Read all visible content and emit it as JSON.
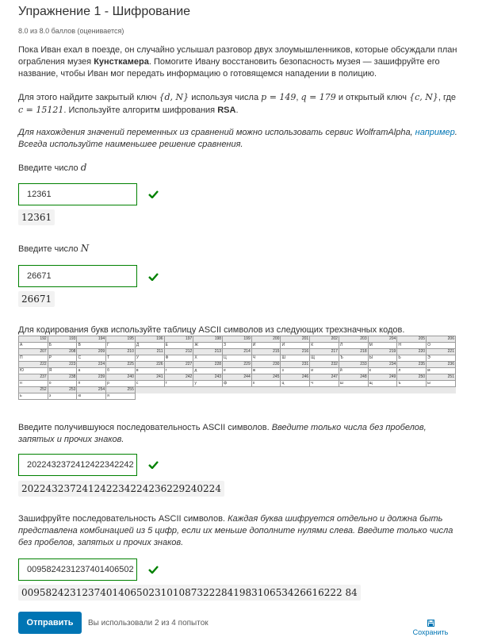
{
  "header": {
    "title": "Упражнение 1 - Шифрование",
    "score": "8.0 из 8.0 баллов (оценивается)"
  },
  "problem": {
    "intro_1": "Пока Иван ехал в поезде, он случайно услышал разговор двух злоумышленников, которые обсуждали план ограбления музея ",
    "intro_bold": "Кунсткамера",
    "intro_2": ". Помогите Ивану восстановить безопасность музея — зашифруйте его название, чтобы Иван мог передать информацию о готовящемся нападении в полицию.",
    "task_1": "Для этого найдите закрытый ключ ",
    "task_key_private": "{d, N}",
    "task_2": " используя числа ",
    "task_p": "p = 149",
    "task_3": ", ",
    "task_q": "q = 179",
    "task_4": " и открытый ключ ",
    "task_key_public": "{c, N}",
    "task_5": ", где ",
    "task_c": "c = 15121",
    "task_6": ". Используйте алгоритм шифрования ",
    "task_bold": "RSA",
    "task_7": ".",
    "hint_1": "Для нахождения значений переменных из сравнений можно использовать сервис WolframAlpha, ",
    "hint_link": "например",
    "hint_2": ". Всегда используйте наименьшее решение сравнения."
  },
  "q1": {
    "label": "Введите число ",
    "var": "d",
    "value": "12361",
    "echo": "12361"
  },
  "q2": {
    "label": "Введите число ",
    "var": "N",
    "value": "26671",
    "echo": "26671"
  },
  "table_caption": "Для кодирования букв используйте таблицу ASCII символов из следующих трехзначных кодов.",
  "ascii_rows": [
    {
      "codes": [
        "192",
        "193",
        "194",
        "195",
        "196",
        "197",
        "198",
        "199",
        "200",
        "201",
        "202",
        "203",
        "204",
        "205",
        "206"
      ],
      "letters": [
        "А",
        "Б",
        "В",
        "Г",
        "Д",
        "Е",
        "Ж",
        "З",
        "И",
        "Й",
        "К",
        "Л",
        "М",
        "Н",
        "О"
      ]
    },
    {
      "codes": [
        "207",
        "208",
        "209",
        "210",
        "211",
        "212",
        "213",
        "214",
        "215",
        "216",
        "217",
        "218",
        "219",
        "220",
        "221"
      ],
      "letters": [
        "П",
        "Р",
        "С",
        "Т",
        "У",
        "Ф",
        "Х",
        "Ц",
        "Ч",
        "Ш",
        "Щ",
        "Ъ",
        "Ы",
        "Ь",
        "Э"
      ]
    },
    {
      "codes": [
        "222",
        "223",
        "224",
        "225",
        "226",
        "227",
        "228",
        "229",
        "230",
        "231",
        "232",
        "233",
        "234",
        "235",
        "236"
      ],
      "letters": [
        "Ю",
        "Я",
        "а",
        "б",
        "в",
        "г",
        "д",
        "е",
        "ж",
        "з",
        "и",
        "й",
        "к",
        "л",
        "м"
      ]
    },
    {
      "codes": [
        "237",
        "238",
        "239",
        "240",
        "241",
        "242",
        "243",
        "244",
        "245",
        "246",
        "247",
        "248",
        "249",
        "250",
        "251"
      ],
      "letters": [
        "н",
        "о",
        "п",
        "р",
        "с",
        "т",
        "у",
        "ф",
        "х",
        "ц",
        "ч",
        "ш",
        "щ",
        "ъ",
        "ы"
      ]
    },
    {
      "codes": [
        "252",
        "253",
        "254",
        "255"
      ],
      "letters": [
        "ь",
        "э",
        "ю",
        "я"
      ]
    }
  ],
  "q3": {
    "label": "Введите получившуюся последовательность ASCII символов. ",
    "label_italic": "Введите только числа без пробелов, запятых и прочих знаков.",
    "value": "2022432372412422342242",
    "echo": "202243237241242234224236229240224"
  },
  "q4": {
    "label": "Зашифруйте последовательность ASCII символов. ",
    "label_italic": "Каждая буква шифруется отдельно и должна быть представлена комбинацией из 5 цифр, если их меньше дополните нулями слева. Введите только числа без пробелов, запятых и прочих знаков.",
    "value": "0095824231237401406502",
    "echo": "00958242312374014065023101087322284198310653426616222 84"
  },
  "footer": {
    "submit_label": "Отправить",
    "attempts": "Вы использовали 2 из 4 попыток",
    "save_label": "Сохранить"
  },
  "colors": {
    "accent": "#0075b4",
    "correct": "#008100"
  },
  "icons": {
    "check": "checkmark-icon",
    "save": "floppy-disk-icon"
  }
}
